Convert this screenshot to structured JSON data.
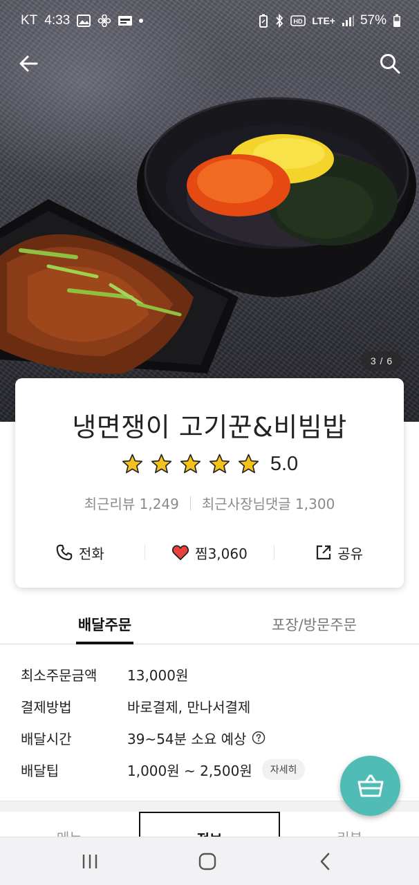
{
  "status_bar": {
    "carrier": "KT",
    "time": "4:33",
    "network": "LTE+",
    "battery": "57%"
  },
  "hero": {
    "image_counter": "3 / 6"
  },
  "store": {
    "name": "냉면쟁이 고기꾼&비빔밥",
    "rating": "5.0",
    "stars": 5,
    "recent_reviews": "최근리뷰 1,249",
    "owner_comments": "최근사장님댓글 1,300"
  },
  "actions": {
    "call_label": "전화",
    "like_label": "찜3,060",
    "share_label": "공유"
  },
  "order_tabs": [
    {
      "label": "배달주문",
      "active": true
    },
    {
      "label": "포장/방문주문",
      "active": false
    }
  ],
  "info": {
    "min_order_label": "최소주문금액",
    "min_order_value": "13,000원",
    "payment_label": "결제방법",
    "payment_value": "바로결제, 만나서결제",
    "delivery_time_label": "배달시간",
    "delivery_time_value": "39~54분 소요 예상",
    "delivery_tip_label": "배달팁",
    "delivery_tip_value": "1,000원 ~ 2,500원",
    "detail_button": "자세히"
  },
  "bottom_tabs": [
    {
      "label": "메뉴",
      "active": false
    },
    {
      "label": "정보",
      "active": true
    },
    {
      "label": "리뷰",
      "active": false
    }
  ],
  "colors": {
    "accent_teal": "#4fbdb6",
    "star_yellow": "#f5c21b",
    "heart_red": "#e8423f"
  }
}
